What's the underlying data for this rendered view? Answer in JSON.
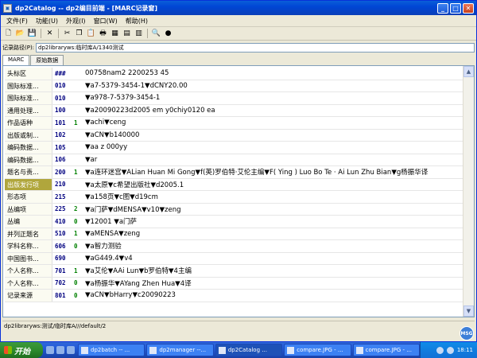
{
  "window": {
    "title": "dp2Catalog -- dp2编目前端 - [MARC记录窗]"
  },
  "menu": [
    "文件(F)",
    "功能(U)",
    "外观(I)",
    "窗口(W)",
    "帮助(H)"
  ],
  "toolbar_icons": [
    "new-icon",
    "open-icon",
    "save-icon",
    "delete-icon",
    "cut-icon",
    "copy-icon",
    "paste-icon",
    "print-icon",
    "calendar-icon",
    "template-icon",
    "bookmark-icon",
    "search-icon",
    "stop-icon"
  ],
  "record_path": {
    "label": "记录路径(P):",
    "value": "dp2libraryws:临时库A/1340测试"
  },
  "tabs": [
    "MARC",
    "原始数据"
  ],
  "marc_rows": [
    {
      "name": "头标区",
      "tag": "###",
      "ind": "",
      "value": "00758nam2 2200253   45"
    },
    {
      "name": "国际标准...",
      "tag": "010",
      "ind": "",
      "value": "▼a7-5379-3454-1▼dCNY20.00"
    },
    {
      "name": "国际标准...",
      "tag": "010",
      "ind": "",
      "value": "▼a978-7-5379-3454-1"
    },
    {
      "name": "通用处理...",
      "tag": "100",
      "ind": "",
      "value": "▼a20090223d2005    em y0chiy0120    ea"
    },
    {
      "name": "作品语种",
      "tag": "101",
      "ind": "1",
      "value": "▼achi▼ceng"
    },
    {
      "name": "出版或制...",
      "tag": "102",
      "ind": "",
      "value": "▼aCN▼b140000"
    },
    {
      "name": "编码数据...",
      "tag": "105",
      "ind": "",
      "value": "▼aa   z   000yy"
    },
    {
      "name": "编码数据...",
      "tag": "106",
      "ind": "",
      "value": "▼ar"
    },
    {
      "name": "题名与责...",
      "tag": "200",
      "ind": "1",
      "value": "▼a连环迷宫▼ALian Huan Mi Gong▼f(英)罗伯特·艾伦主编▼F( Ying ) Luo Bo Te · Ai Lun Zhu Bian▼g杨振华译"
    },
    {
      "name": "出版发行项",
      "tag": "210",
      "ind": "",
      "value": "▼a太原▼c希望出版社▼d2005.1",
      "selected": true
    },
    {
      "name": "形态项",
      "tag": "215",
      "ind": "",
      "value": "▼a158页▼c图▼d19cm"
    },
    {
      "name": "丛编项",
      "tag": "225",
      "ind": "2",
      "value": "▼a门萨▼dMENSA▼v10▼zeng"
    },
    {
      "name": "丛编",
      "tag": "410",
      "ind": "0",
      "value": "▼12001 ▼a门萨"
    },
    {
      "name": "并列正题名",
      "tag": "510",
      "ind": "1",
      "value": "▼aMENSA▼zeng"
    },
    {
      "name": "学科名称...",
      "tag": "606",
      "ind": "0",
      "value": "▼a智力测验"
    },
    {
      "name": "中国图书...",
      "tag": "690",
      "ind": "",
      "value": "▼aG449.4▼v4"
    },
    {
      "name": "个人名称...",
      "tag": "701",
      "ind": "1",
      "value": "▼a艾伦▼AAi Lun▼b罗伯特▼4主编"
    },
    {
      "name": "个人名称...",
      "tag": "702",
      "ind": "0",
      "value": "▼a杨振华▼AYang Zhen Hua▼4译"
    },
    {
      "name": "记录来源",
      "tag": "801",
      "ind": "0",
      "value": "▼aCN▼bHarry▼c20090223"
    }
  ],
  "status": "dp2libraryws:测试/临时库A///default/2",
  "taskbar": {
    "start": "开始",
    "buttons": [
      "dp2batch -- ...",
      "dp2manager --...",
      "dp2Catalog ...",
      "compare.JPG - ...",
      "compare.JPG - ..."
    ],
    "clock": "18:11"
  },
  "badge": "MSG"
}
